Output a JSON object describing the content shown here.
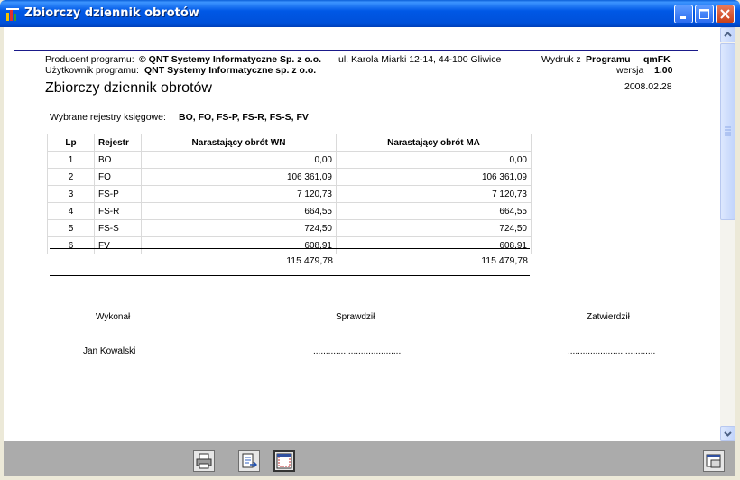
{
  "window": {
    "title": "Zbiorczy dziennik obrotów",
    "colors": {
      "titlebar": "#0058E6",
      "close": "#C8401A"
    }
  },
  "report": {
    "producer_label": "Producent programu:",
    "producer_value": "© QNT Systemy Informatyczne Sp. z o.o.",
    "producer_address": "ul. Karola Miarki 12-14, 44-100 Gliwice",
    "printout_label": "Wydruk z",
    "printout_program_label": "Programu",
    "printout_program": "qmFK",
    "user_label": "Użytkownik programu:",
    "user_value": "QNT Systemy Informatyczne sp. z o.o.",
    "version_label": "wersja",
    "version_value": "1.00",
    "title": "Zbiorczy dziennik obrotów",
    "date": "2008.02.28",
    "registers_label": "Wybrane rejestry księgowe:",
    "registers_value": "BO, FO, FS-P, FS-R, FS-S, FV",
    "columns": [
      "Lp",
      "Rejestr",
      "Narastający obrót WN",
      "Narastający obrót MA"
    ],
    "rows": [
      {
        "lp": "1",
        "rejestr": "BO",
        "wn": "0,00",
        "ma": "0,00"
      },
      {
        "lp": "2",
        "rejestr": "FO",
        "wn": "106 361,09",
        "ma": "106 361,09"
      },
      {
        "lp": "3",
        "rejestr": "FS-P",
        "wn": "7 120,73",
        "ma": "7 120,73"
      },
      {
        "lp": "4",
        "rejestr": "FS-R",
        "wn": "664,55",
        "ma": "664,55"
      },
      {
        "lp": "5",
        "rejestr": "FS-S",
        "wn": "724,50",
        "ma": "724,50"
      },
      {
        "lp": "6",
        "rejestr": "FV",
        "wn": "608,91",
        "ma": "608,91"
      }
    ],
    "total_wn": "115 479,78",
    "total_ma": "115 479,78",
    "signatures": {
      "performed_label": "Wykonał",
      "checked_label": "Sprawdził",
      "approved_label": "Zatwierdził",
      "performed_name": "Jan Kowalski",
      "checked_line": "...................................",
      "approved_line": "..................................."
    }
  },
  "toolbar": {
    "icons": [
      "printer-icon",
      "export-icon",
      "page-setup-icon",
      "close-preview-icon"
    ]
  }
}
